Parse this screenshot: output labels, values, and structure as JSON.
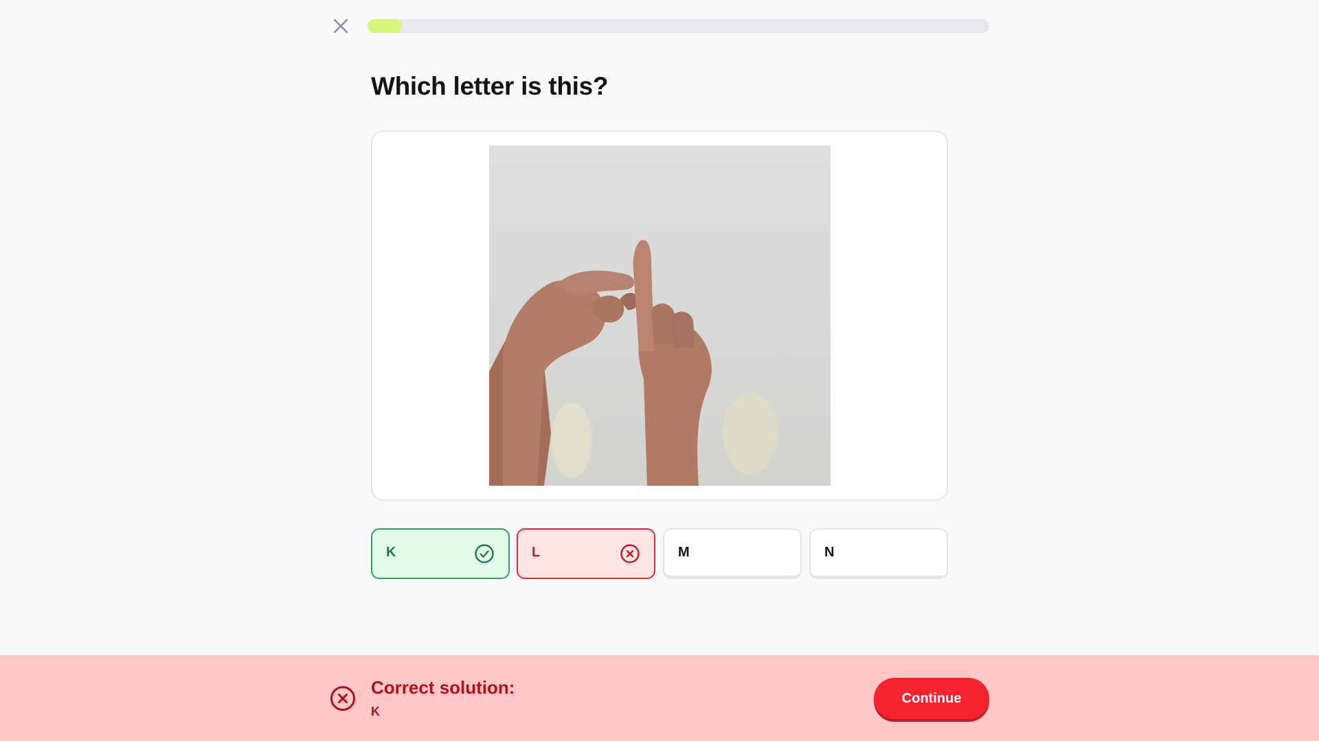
{
  "header": {
    "close_icon": "close-icon",
    "progress_fraction": 0.055
  },
  "question": {
    "title": "Which letter is this?",
    "image": "hand-sign-photo"
  },
  "options": [
    {
      "letter": "K",
      "state": "correct",
      "icon": "check-circle-icon"
    },
    {
      "letter": "L",
      "state": "wrong",
      "icon": "x-circle-icon"
    },
    {
      "letter": "M",
      "state": "default"
    },
    {
      "letter": "N",
      "state": "default"
    }
  ],
  "feedback": {
    "icon": "x-circle-icon",
    "title": "Correct solution:",
    "answer": "K",
    "continue_label": "Continue"
  },
  "colors": {
    "progress": "#d6f57a",
    "correct": "#2fa35b",
    "wrong": "#e3262f",
    "feedback_bg": "#ffc7c7",
    "continue_bg": "#f5232f"
  }
}
